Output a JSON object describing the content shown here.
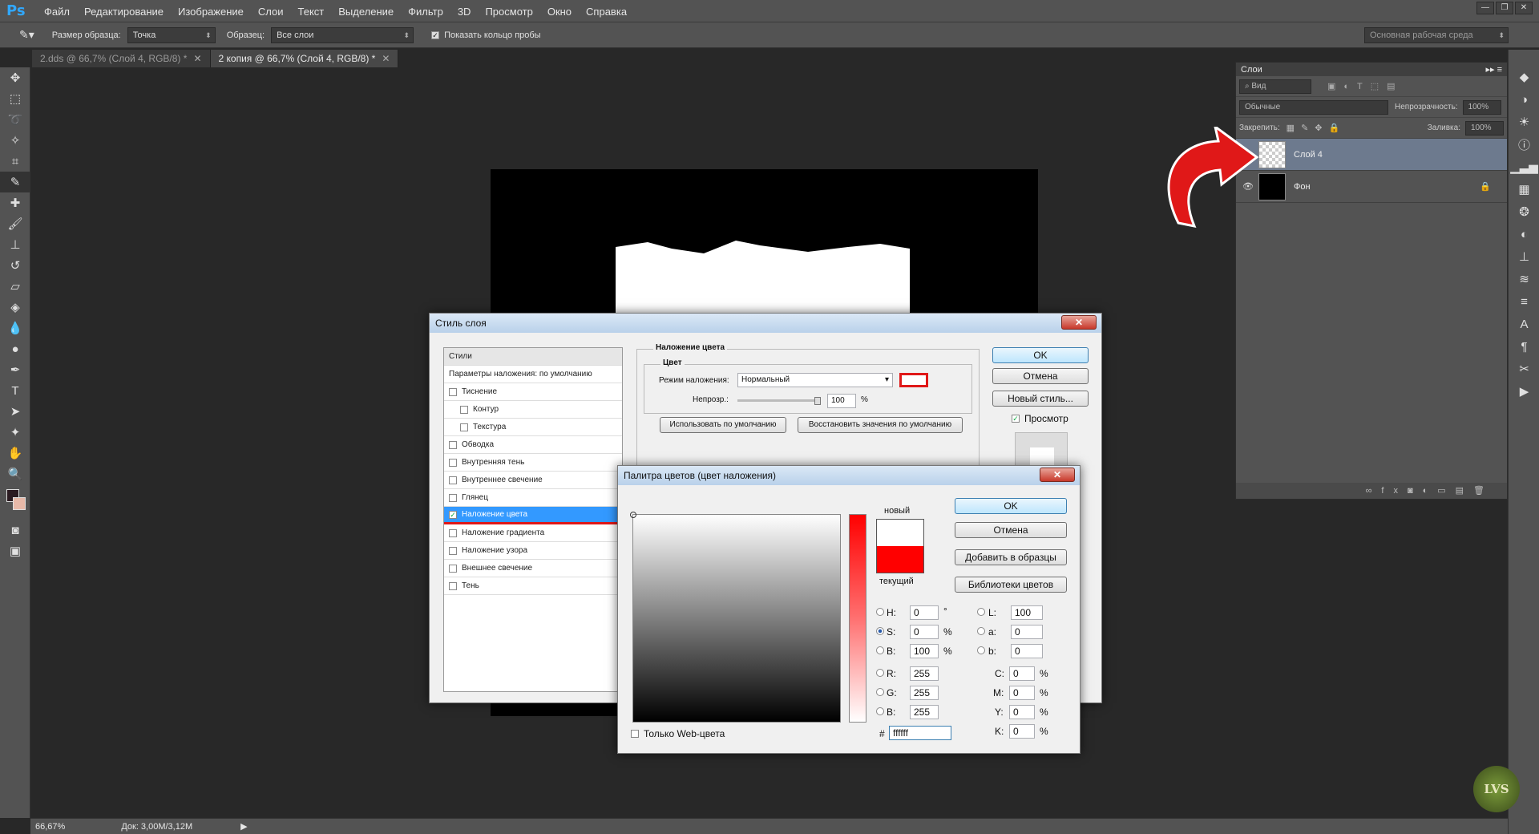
{
  "app": {
    "logo": "Ps"
  },
  "menu": [
    "Файл",
    "Редактирование",
    "Изображение",
    "Слои",
    "Текст",
    "Выделение",
    "Фильтр",
    "3D",
    "Просмотр",
    "Окно",
    "Справка"
  ],
  "options": {
    "sample_size_label": "Размер образца:",
    "sample_size": "Точка",
    "sample_label": "Образец:",
    "sample": "Все слои",
    "show_ring": "Показать кольцо пробы",
    "workspace": "Основная рабочая среда"
  },
  "tabs": [
    {
      "label": "2.dds @ 66,7% (Слой 4, RGB/8) *"
    },
    {
      "label": "2 копия @ 66,7% (Слой 4, RGB/8) *"
    }
  ],
  "status": {
    "zoom": "66,67%",
    "doc": "Док: 3,00M/3,12M"
  },
  "layers_panel": {
    "title": "Слои",
    "filter": "Вид",
    "blend": "Обычные",
    "opacity_label": "Непрозрачность:",
    "opacity": "100%",
    "lock_label": "Закрепить:",
    "fill_label": "Заливка:",
    "fill": "100%",
    "layers": [
      {
        "name": "Слой 4"
      },
      {
        "name": "Фон"
      }
    ]
  },
  "layer_style": {
    "title": "Стиль слоя",
    "styles_header": "Стили",
    "blend_defaults": "Параметры наложения: по умолчанию",
    "items": [
      {
        "label": "Тиснение",
        "checked": false
      },
      {
        "label": "Контур",
        "checked": false
      },
      {
        "label": "Текстура",
        "checked": false
      },
      {
        "label": "Обводка",
        "checked": false
      },
      {
        "label": "Внутренняя тень",
        "checked": false
      },
      {
        "label": "Внутреннее свечение",
        "checked": false
      },
      {
        "label": "Глянец",
        "checked": false
      },
      {
        "label": "Наложение цвета",
        "checked": true
      },
      {
        "label": "Наложение градиента",
        "checked": false
      },
      {
        "label": "Наложение узора",
        "checked": false
      },
      {
        "label": "Внешнее свечение",
        "checked": false
      },
      {
        "label": "Тень",
        "checked": false
      }
    ],
    "section_title": "Наложение цвета",
    "subsection": "Цвет",
    "blend_mode_label": "Режим наложения:",
    "blend_mode": "Нормальный",
    "opacity_label": "Непрозр.:",
    "opacity": "100",
    "percent": "%",
    "use_default": "Использовать по умолчанию",
    "restore_default": "Восстановить значения по умолчанию",
    "ok": "OK",
    "cancel": "Отмена",
    "new_style": "Новый стиль...",
    "preview": "Просмотр"
  },
  "color_picker": {
    "title": "Палитра цветов (цвет наложения)",
    "new_label": "новый",
    "current_label": "текущий",
    "ok": "OK",
    "cancel": "Отмена",
    "add_swatch": "Добавить в образцы",
    "libraries": "Библиотеки цветов",
    "web_only": "Только Web-цвета",
    "H": "0",
    "S": "0",
    "B": "100",
    "R": "255",
    "G": "255",
    "Bv": "255",
    "L": "100",
    "a": "0",
    "b": "0",
    "C": "0",
    "M": "0",
    "Y": "0",
    "K": "0",
    "hex": "ffffff",
    "deg": "°",
    "pct": "%",
    "hash": "#",
    "lbl_H": "H:",
    "lbl_S": "S:",
    "lbl_B": "B:",
    "lbl_R": "R:",
    "lbl_G": "G:",
    "lbl_B2": "B:",
    "lbl_L": "L:",
    "lbl_a": "a:",
    "lbl_b": "b:",
    "lbl_C": "C:",
    "lbl_M": "M:",
    "lbl_Y": "Y:",
    "lbl_K": "K:"
  },
  "colors": {
    "current": "#ff0000",
    "new": "#ffffff",
    "accent": "#3399ff"
  }
}
